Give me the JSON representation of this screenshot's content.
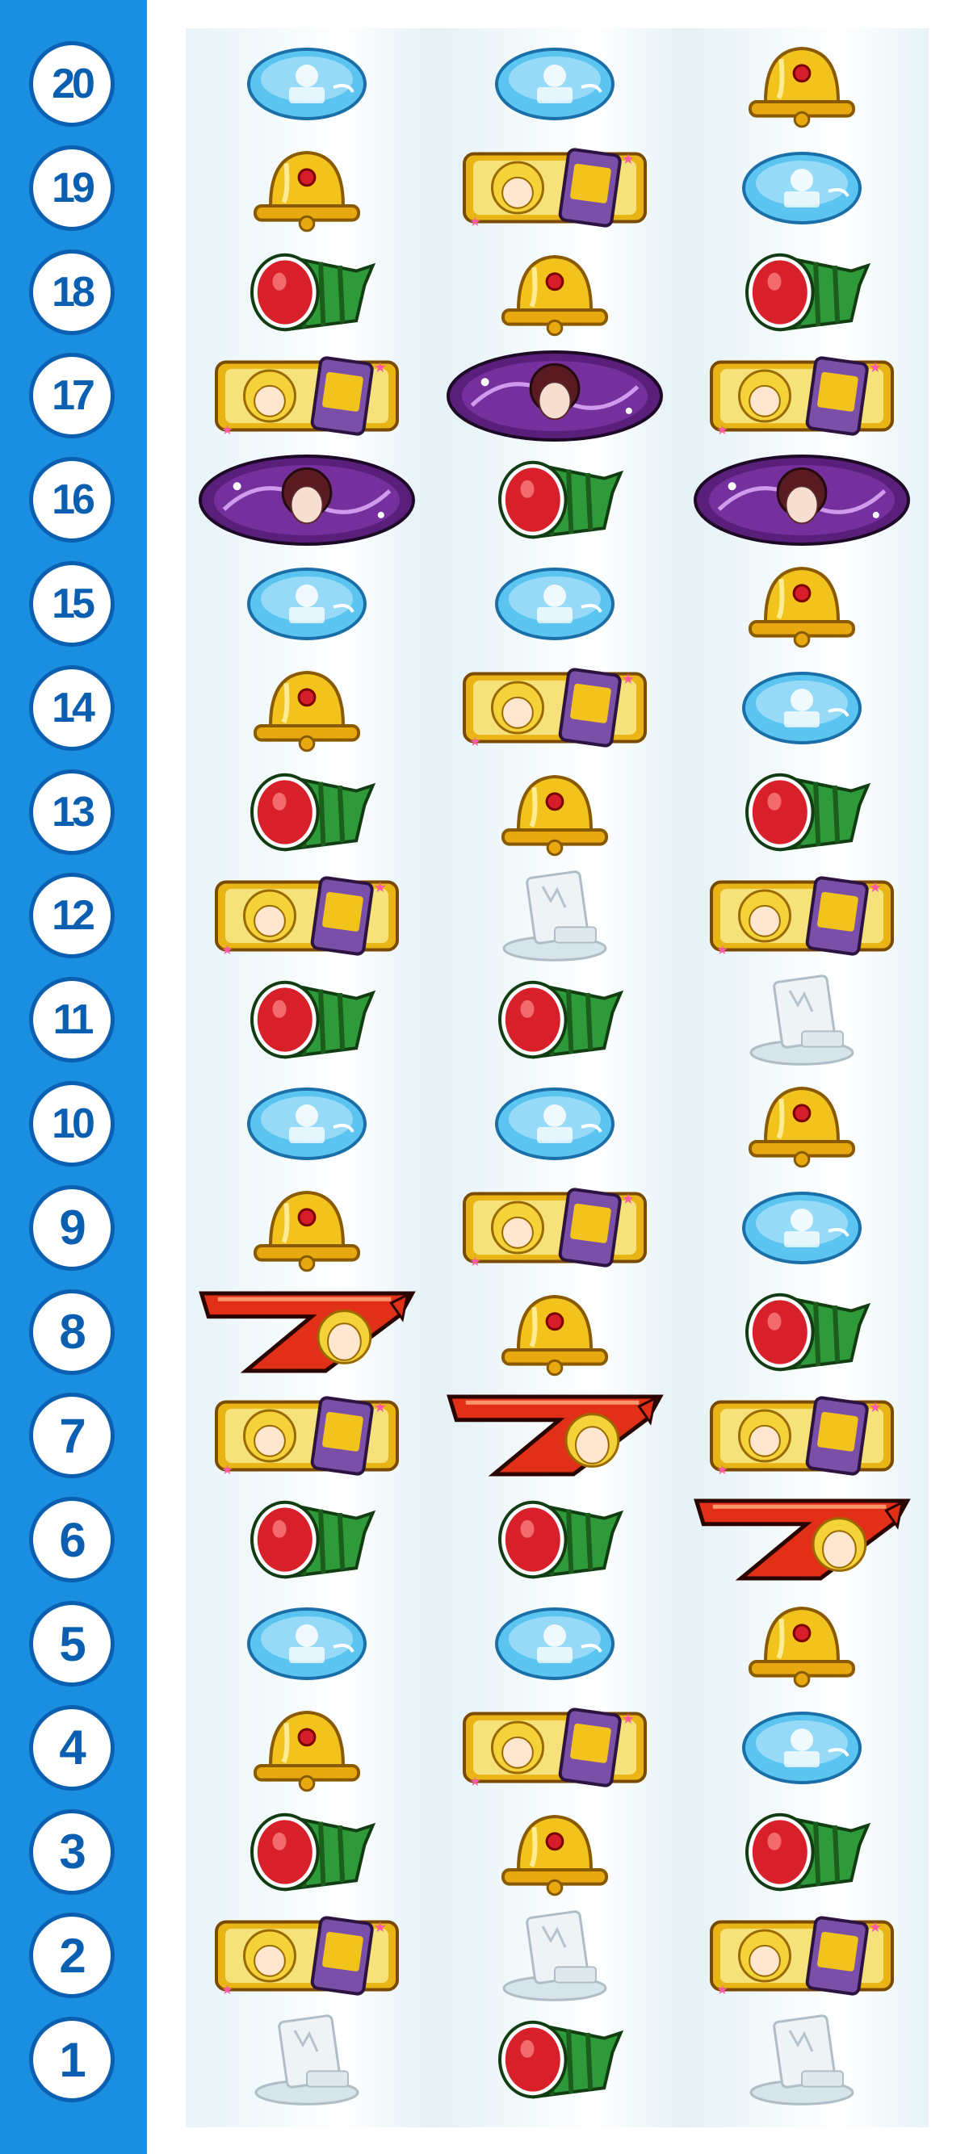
{
  "reel_strip": {
    "row_numbers": [
      "20",
      "19",
      "18",
      "17",
      "16",
      "15",
      "14",
      "13",
      "12",
      "11",
      "10",
      "9",
      "8",
      "7",
      "6",
      "5",
      "4",
      "3",
      "2",
      "1"
    ],
    "reels": [
      [
        "replay",
        "bell",
        "watermelon",
        "cherry-girl",
        "purple-girl",
        "replay",
        "bell",
        "watermelon",
        "cherry-girl",
        "watermelon",
        "replay",
        "bell",
        "seven",
        "cherry-girl",
        "watermelon",
        "replay",
        "bell",
        "watermelon",
        "cherry-girl",
        "blank"
      ],
      [
        "replay",
        "cherry-girl",
        "bell",
        "purple-girl",
        "watermelon",
        "replay",
        "cherry-girl",
        "bell",
        "blank",
        "watermelon",
        "replay",
        "cherry-girl",
        "bell",
        "seven",
        "watermelon",
        "replay",
        "cherry-girl",
        "bell",
        "blank",
        "watermelon"
      ],
      [
        "bell",
        "replay",
        "watermelon",
        "cherry-girl",
        "purple-girl",
        "bell",
        "replay",
        "watermelon",
        "cherry-girl",
        "blank",
        "bell",
        "replay",
        "watermelon",
        "cherry-girl",
        "seven",
        "bell",
        "replay",
        "watermelon",
        "cherry-girl",
        "blank"
      ]
    ],
    "symbol_names": {
      "replay": "replay-symbol",
      "bell": "bell-symbol",
      "watermelon": "watermelon-symbol",
      "cherry-girl": "cherry-girl-symbol",
      "purple-girl": "purple-girl-symbol",
      "seven": "red-seven-symbol",
      "blank": "blank-symbol"
    },
    "colors": {
      "sidebar": "#1a8ee0",
      "badge_border": "#0b5fb0",
      "replay": "#5bc4f0",
      "bell": "#f2c21d",
      "watermelon_red": "#d8202a",
      "watermelon_green": "#2f9a3a",
      "cherry_frame": "#e8b416",
      "purple": "#5a1f7a",
      "seven_red": "#e23018"
    }
  }
}
